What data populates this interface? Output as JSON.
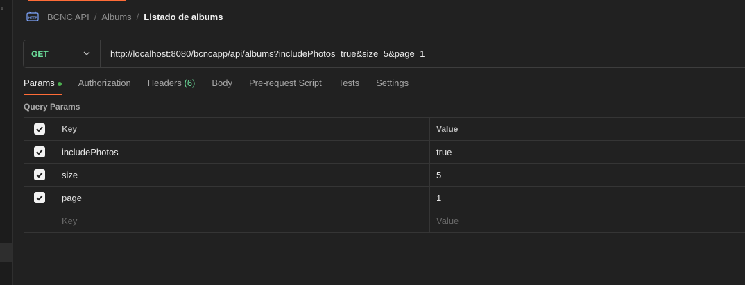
{
  "breadcrumb": {
    "items": [
      "BCNC API",
      "Albums"
    ],
    "current": "Listado de albums",
    "separator": "/"
  },
  "request": {
    "method": "GET",
    "url": "http://localhost:8080/bcncapp/api/albums?includePhotos=true&size=5&page=1"
  },
  "tabs": {
    "params": "Params",
    "authorization": "Authorization",
    "headers": "Headers",
    "headers_count": "(6)",
    "body": "Body",
    "prerequest": "Pre-request Script",
    "tests": "Tests",
    "settings": "Settings"
  },
  "query_params": {
    "title": "Query Params",
    "header_key": "Key",
    "header_value": "Value",
    "rows": [
      {
        "key": "includePhotos",
        "value": "true",
        "checked": true
      },
      {
        "key": "size",
        "value": "5",
        "checked": true
      },
      {
        "key": "page",
        "value": "1",
        "checked": true
      }
    ],
    "placeholder_key": "Key",
    "placeholder_value": "Value"
  },
  "colors": {
    "accent": "#ff6c37",
    "method_get": "#6bdd9a",
    "background": "#212121"
  }
}
